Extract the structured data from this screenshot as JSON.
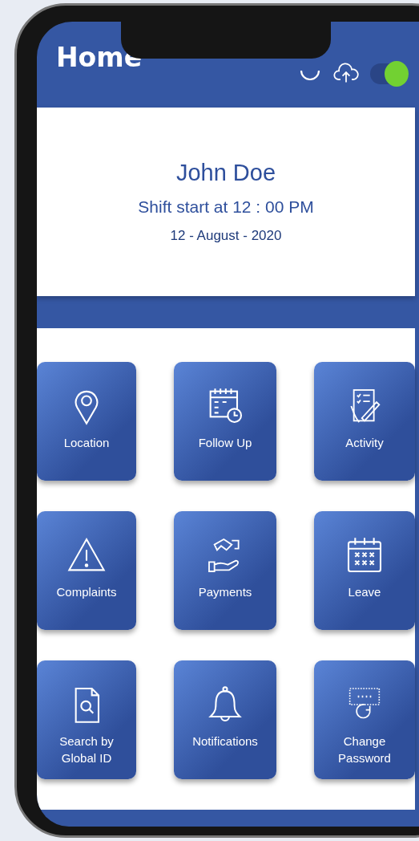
{
  "header": {
    "title": "Home",
    "sync_toggle": {
      "on": true
    }
  },
  "profile": {
    "name": "John Doe",
    "shift": "Shift start at 12 : 00 PM",
    "date": "12 - August - 2020"
  },
  "tiles": [
    {
      "label": "Location"
    },
    {
      "label": "Follow Up"
    },
    {
      "label": "Activity"
    },
    {
      "label": "Complaints"
    },
    {
      "label": "Payments"
    },
    {
      "label": "Leave"
    },
    {
      "label": "Search by Global ID"
    },
    {
      "label": "Notifications"
    },
    {
      "label": "Change Password"
    }
  ]
}
